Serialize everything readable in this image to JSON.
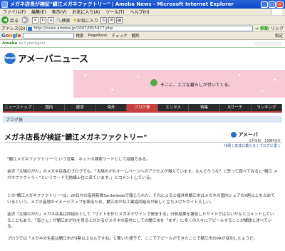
{
  "window": {
    "title": "メガネ店長が検証\"鯖江メガネファクトリー\" | Ameba News - Microsoft Internet Explorer"
  },
  "menu": [
    "ファイル(F)",
    "編集(E)",
    "表示(V)",
    "お気に入り(A)",
    "ツール(T)",
    "ヘルプ(H)"
  ],
  "toolbar": {
    "back": "戻る",
    "search": "検索",
    "favorites": "お気に入り"
  },
  "address": {
    "label": "アドレス(D)",
    "url": "http://news.ameba.jp/2007/05/5477.php",
    "go": "移動",
    "links": "リンク"
  },
  "google": {
    "label": "Google",
    "search_btn": "検索",
    "pagerank": "PageRank",
    "check": "チェック",
    "translate": "翻訳",
    "settings": "設定"
  },
  "page": {
    "ameba_bar": "Ameba",
    "cyberagent": "by CyberAgent",
    "logo_badge": "Ameba",
    "logo_text": "アメーバニュース",
    "ad_caption": "そこに、エコな暮らしが付いてくる。",
    "nav": [
      "ニューストップ",
      "国内",
      "経済",
      "海外",
      "ブログ発",
      "エンタメ",
      "特集",
      "Rサーチ",
      "ランキング"
    ],
    "nav_active": 4,
    "section": "ブログ発",
    "headline": "メガネ店長が検証\"鯖江メガネファクトリー\"",
    "source": "アメーバ",
    "date": "5月9日　15時49分",
    "tools": "印刷 | 友達に教える | ブログに書く",
    "paragraphs": [
      "\"鯖江メガネファクトリー\"という言葉、ネットの検索ワードとして話題である。",
      "金沢「太陽のがわ」のメガネ店長のブログでも、「太陽のがわホームページへのアクセスが増えています。なんだろうな？と思って調べてみると\"鯖江 メガネファクトリー\"というワードで結構上位に来ています。」とコメントしている。",
      "この\"鯖江メガネファクトリー\"は、26日付の産経新聞Sankeiwebで報じられた。それによると福井県鯖江市はメガネの国内シェアの9割以上を占めているという。メガネ産地のイメージアップを図るため、鯖江めがね工業協同組合が新しく立ち上げたサイトらしい。",
      "金沢「太陽のがわ」メガネ店長は同組合として「サイトを作りメガネデザインで発信する」分析結果を報告したサイトではないかなとコメントしていることもあり、「皆さん」が鯖江めがねを見ると分かるがメガネの産地としての鯖江市を「まず」に多くの人々にアピールすることが課題と述べている。",
      "ブログでは「メガネの生産は鯖江市が9割以上なんですね」と驚いた様子で、ここでアピールができたことで鯖江市のPRが成功したようだ。"
    ]
  },
  "colors": {
    "nav_active": "#c83e3e",
    "ad_bg": "#f8cad8",
    "section_bg": "#dce8f4",
    "brand_green": "#2a8a2a"
  }
}
